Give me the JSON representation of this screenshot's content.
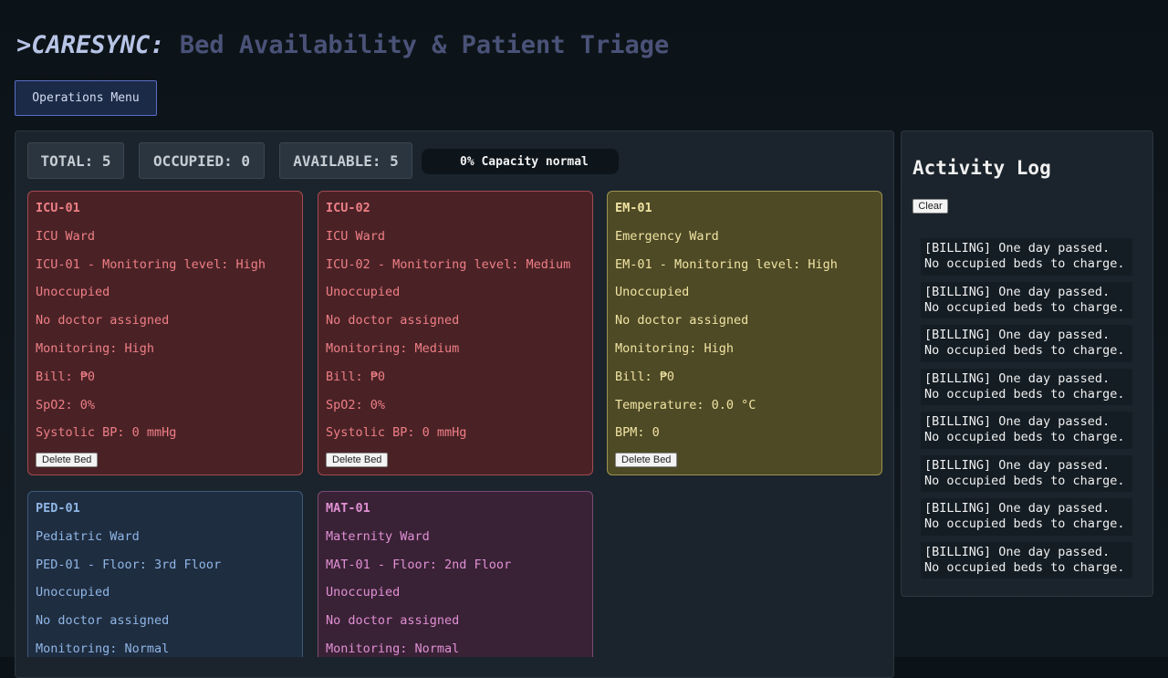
{
  "header": {
    "brand": ">CARESYNC:",
    "subtitle": "Bed Availability & Patient Triage",
    "ops_menu_label": "Operations Menu"
  },
  "stats": {
    "total": "TOTAL: 5",
    "occupied": "OCCUPIED: 0",
    "available": "AVAILABLE: 5",
    "capacity": "0% Capacity normal"
  },
  "beds": [
    {
      "id": "ICU-01",
      "ward": "ICU Ward",
      "detail": "ICU-01 - Monitoring level: High",
      "status": "Unoccupied",
      "doctor": "No doctor assigned",
      "monitoring": "Monitoring: High",
      "bill": "Bill: ₱0",
      "vital1": "SpO2: 0%",
      "vital2": "Systolic BP: 0 mmHg",
      "delete_label": "Delete Bed"
    },
    {
      "id": "ICU-02",
      "ward": "ICU Ward",
      "detail": "ICU-02 - Monitoring level: Medium",
      "status": "Unoccupied",
      "doctor": "No doctor assigned",
      "monitoring": "Monitoring: Medium",
      "bill": "Bill: ₱0",
      "vital1": "SpO2: 0%",
      "vital2": "Systolic BP: 0 mmHg",
      "delete_label": "Delete Bed"
    },
    {
      "id": "EM-01",
      "ward": "Emergency Ward",
      "detail": "EM-01 - Monitoring level: High",
      "status": "Unoccupied",
      "doctor": "No doctor assigned",
      "monitoring": "Monitoring: High",
      "bill": "Bill: ₱0",
      "vital1": "Temperature: 0.0 °C",
      "vital2": "BPM: 0",
      "delete_label": "Delete Bed"
    },
    {
      "id": "PED-01",
      "ward": "Pediatric Ward",
      "detail": "PED-01 - Floor: 3rd Floor",
      "status": "Unoccupied",
      "doctor": "No doctor assigned",
      "monitoring": "Monitoring: Normal"
    },
    {
      "id": "MAT-01",
      "ward": "Maternity Ward",
      "detail": "MAT-01 - Floor: 2nd Floor",
      "status": "Unoccupied",
      "doctor": "No doctor assigned",
      "monitoring": "Monitoring: Normal"
    }
  ],
  "log": {
    "title": "Activity Log",
    "clear_label": "Clear",
    "entries": [
      "[BILLING] One day passed. No occupied beds to charge.",
      "[BILLING] One day passed. No occupied beds to charge.",
      "[BILLING] One day passed. No occupied beds to charge.",
      "[BILLING] One day passed. No occupied beds to charge.",
      "[BILLING] One day passed. No occupied beds to charge.",
      "[BILLING] One day passed. No occupied beds to charge.",
      "[BILLING] One day passed. No occupied beds to charge.",
      "[BILLING] One day passed. No occupied beds to charge."
    ]
  },
  "colors": {
    "icu": "#ef7f86",
    "emergency": "#f0e3a2",
    "pediatric": "#8fb6e6",
    "maternity": "#e090d4"
  }
}
